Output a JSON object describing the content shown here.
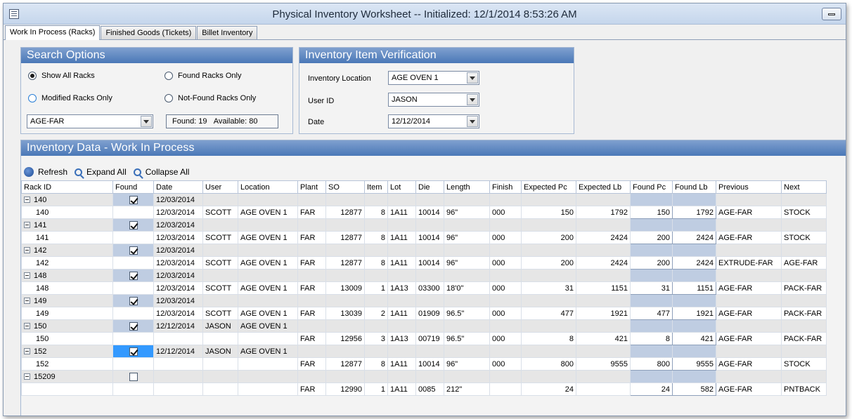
{
  "window": {
    "title": "Physical Inventory Worksheet  -- Initialized: 12/1/2014 8:53:26 AM"
  },
  "tabs": [
    {
      "label": "Work In Process (Racks)",
      "active": true
    },
    {
      "label": "Finished Goods (Tickets)",
      "active": false
    },
    {
      "label": "Billet Inventory",
      "active": false
    }
  ],
  "search": {
    "header": "Search Options",
    "show_all": "Show All Racks",
    "found_only": "Found Racks Only",
    "modified_only": "Modified Racks Only",
    "not_found_only": "Not-Found Racks Only",
    "location_value": "AGE-FAR",
    "found_count": "Found: 19",
    "available_count": "Available: 80"
  },
  "verification": {
    "header": "Inventory Item Verification",
    "location_label": "Inventory Location",
    "location_value": "AGE OVEN 1",
    "user_label": "User ID",
    "user_value": "JASON",
    "date_label": "Date",
    "date_value": "12/12/2014"
  },
  "data_panel": {
    "header": "Inventory Data - Work In Process",
    "refresh": "Refresh",
    "expand_all": "Expand All",
    "collapse_all": "Collapse All"
  },
  "grid": {
    "columns": [
      "Rack ID",
      "Found",
      "Date",
      "User",
      "Location",
      "Plant",
      "SO",
      "Item",
      "Lot",
      "Die",
      "Length",
      "Finish",
      "Expected Pc",
      "Expected Lb",
      "Found Pc",
      "Found Lb",
      "Previous",
      "Next"
    ],
    "groups": [
      {
        "rack": "140",
        "found": true,
        "date": "12/03/2014",
        "user": "",
        "location": "",
        "detail": {
          "rack": "140",
          "date": "12/03/2014",
          "user": "SCOTT",
          "location": "AGE OVEN 1",
          "plant": "FAR",
          "so": "12877",
          "item": "8",
          "lot": "1A11",
          "die": "10014",
          "length": "96\"",
          "finish": "000",
          "exp_pc": "150",
          "exp_lb": "1792",
          "found_pc": "150",
          "found_lb": "1792",
          "previous": "AGE-FAR",
          "next": "STOCK"
        }
      },
      {
        "rack": "141",
        "found": true,
        "date": "12/03/2014",
        "user": "",
        "location": "",
        "detail": {
          "rack": "141",
          "date": "12/03/2014",
          "user": "SCOTT",
          "location": "AGE OVEN 1",
          "plant": "FAR",
          "so": "12877",
          "item": "8",
          "lot": "1A11",
          "die": "10014",
          "length": "96\"",
          "finish": "000",
          "exp_pc": "200",
          "exp_lb": "2424",
          "found_pc": "200",
          "found_lb": "2424",
          "previous": "AGE-FAR",
          "next": "STOCK"
        }
      },
      {
        "rack": "142",
        "found": true,
        "date": "12/03/2014",
        "user": "",
        "location": "",
        "detail": {
          "rack": "142",
          "date": "12/03/2014",
          "user": "SCOTT",
          "location": "AGE OVEN 1",
          "plant": "FAR",
          "so": "12877",
          "item": "8",
          "lot": "1A11",
          "die": "10014",
          "length": "96\"",
          "finish": "000",
          "exp_pc": "200",
          "exp_lb": "2424",
          "found_pc": "200",
          "found_lb": "2424",
          "previous": "EXTRUDE-FAR",
          "next": "AGE-FAR"
        }
      },
      {
        "rack": "148",
        "found": true,
        "date": "12/03/2014",
        "user": "",
        "location": "",
        "detail": {
          "rack": "148",
          "date": "12/03/2014",
          "user": "SCOTT",
          "location": "AGE OVEN 1",
          "plant": "FAR",
          "so": "13009",
          "item": "1",
          "lot": "1A13",
          "die": "03300",
          "length": "18'0\"",
          "finish": "000",
          "exp_pc": "31",
          "exp_lb": "1151",
          "found_pc": "31",
          "found_lb": "1151",
          "previous": "AGE-FAR",
          "next": "PACK-FAR"
        }
      },
      {
        "rack": "149",
        "found": true,
        "date": "12/03/2014",
        "user": "",
        "location": "",
        "detail": {
          "rack": "149",
          "date": "12/03/2014",
          "user": "SCOTT",
          "location": "AGE OVEN 1",
          "plant": "FAR",
          "so": "13039",
          "item": "2",
          "lot": "1A11",
          "die": "01909",
          "length": "96.5\"",
          "finish": "000",
          "exp_pc": "477",
          "exp_lb": "1921",
          "found_pc": "477",
          "found_lb": "1921",
          "previous": "AGE-FAR",
          "next": "PACK-FAR"
        }
      },
      {
        "rack": "150",
        "found": true,
        "date": "12/12/2014",
        "user": "JASON",
        "location": "AGE OVEN 1",
        "detail": {
          "rack": "150",
          "date": "",
          "user": "",
          "location": "",
          "plant": "FAR",
          "so": "12956",
          "item": "3",
          "lot": "1A13",
          "die": "00719",
          "length": "96.5\"",
          "finish": "000",
          "exp_pc": "8",
          "exp_lb": "421",
          "found_pc": "8",
          "found_lb": "421",
          "previous": "AGE-FAR",
          "next": "PACK-FAR"
        }
      },
      {
        "rack": "152",
        "found": true,
        "selected": true,
        "date": "12/12/2014",
        "user": "JASON",
        "location": "AGE OVEN 1",
        "detail": {
          "rack": "152",
          "date": "",
          "user": "",
          "location": "",
          "plant": "FAR",
          "so": "12877",
          "item": "8",
          "lot": "1A11",
          "die": "10014",
          "length": "96\"",
          "finish": "000",
          "exp_pc": "800",
          "exp_lb": "9555",
          "found_pc": "800",
          "found_lb": "9555",
          "previous": "AGE-FAR",
          "next": "STOCK"
        }
      },
      {
        "rack": "15209",
        "found": false,
        "date": "",
        "user": "",
        "location": "",
        "detail": {
          "rack": "",
          "date": "",
          "user": "",
          "location": "",
          "plant": "FAR",
          "so": "12990",
          "item": "1",
          "lot": "1A11",
          "die": "0085",
          "length": "212\"",
          "finish": "",
          "exp_pc": "24",
          "exp_lb": "",
          "found_pc": "24",
          "found_lb": "582",
          "previous": "AGE-FAR",
          "next": "PNTBACK"
        }
      }
    ]
  }
}
